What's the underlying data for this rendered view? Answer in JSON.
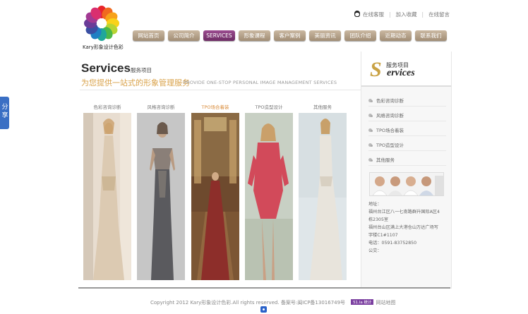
{
  "share": {
    "label": "分享"
  },
  "brand": {
    "logo_text": "Kary形象设计色彩"
  },
  "toplinks": [
    "在线客服",
    "加入收藏",
    "在线留言"
  ],
  "nav": {
    "items": [
      "网站首页",
      "公司简介",
      "SERVICES",
      "形象课程",
      "客户案例",
      "美丽资讯",
      "团队介绍",
      "近期动态",
      "联系我们"
    ],
    "active_index": 2
  },
  "main": {
    "title": "Services",
    "subtitle": "服务项目",
    "slogan_cn": "为您提供一站式的形象管理服务",
    "slogan_en": "PROVIDE ONE-STOP PERSONAL IMAGE MANAGEMENT SERVICES",
    "gallery": [
      {
        "caption": "色彩咨询诊断",
        "highlight": false
      },
      {
        "caption": "风格咨询诊断",
        "highlight": false
      },
      {
        "caption": "TPO场合着装",
        "highlight": true
      },
      {
        "caption": "TPO造型设计",
        "highlight": false
      },
      {
        "caption": "其他服务",
        "highlight": false
      }
    ]
  },
  "sidebar": {
    "S_letter": "S",
    "title_cn": "服务项目",
    "title_en": "ervices",
    "items": [
      "色彩咨询诊断",
      "风格咨询诊断",
      "TPO场合着装",
      "TPO造型设计",
      "其他服务"
    ],
    "contact": [
      "地址：",
      "福州台江区八一七南路群升国际A区4",
      "栋2305室",
      "福州台山区满上大港仓山万达广场写",
      "字楼C1#1107",
      "电话：0591-83752850",
      "公交："
    ]
  },
  "footer": {
    "copyright": "Copyright 2012 Kary形象设计色彩.All rights reserved. 备案号:闽ICP备13016749号",
    "badge": "51.la 统计",
    "sitemap": "网站地图"
  },
  "colors": {
    "nav": "#b6a38b",
    "nav_active": "#7e3474",
    "accent_gold": "#d9a24a",
    "share_blue": "#3a6fc4"
  }
}
